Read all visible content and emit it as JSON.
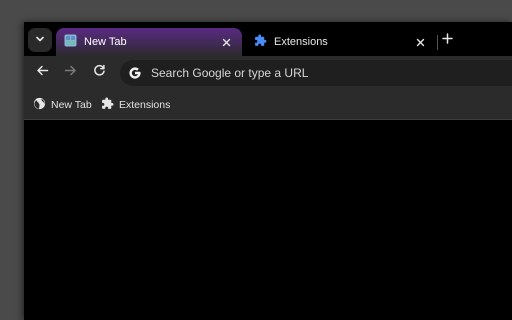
{
  "tabs": [
    {
      "label": "New Tab",
      "active": true,
      "icon": "new-tab-page-icon"
    },
    {
      "label": "Extensions",
      "active": false,
      "icon": "puzzle-icon"
    }
  ],
  "omnibox": {
    "placeholder": "Search Google or type a URL"
  },
  "bookmarks": [
    {
      "label": "New Tab",
      "icon": "globe-icon"
    },
    {
      "label": "Extensions",
      "icon": "puzzle-icon"
    }
  ],
  "colors": {
    "active_tab_accent": "#5a2a82",
    "toolbar": "#2b2b2b",
    "extensions_icon": "#4a8cf7"
  }
}
